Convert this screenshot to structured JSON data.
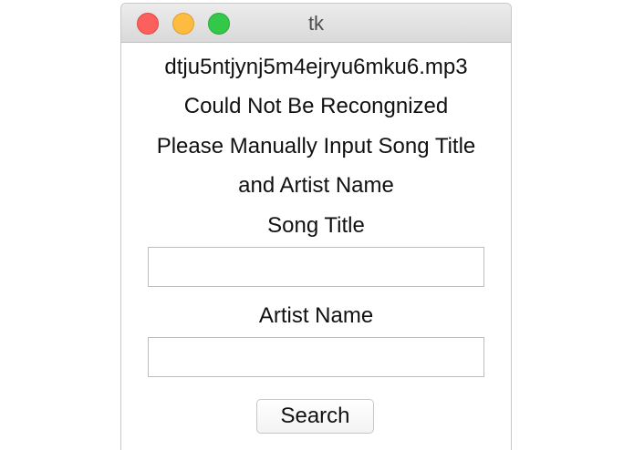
{
  "window": {
    "title": "tk"
  },
  "message": {
    "filename": "dtju5ntjynj5m4ejryu6mku6.mp3",
    "status": "Could Not Be Recongnized",
    "instruction_line1": "Please Manually Input Song Title",
    "instruction_line2": "and Artist Name"
  },
  "form": {
    "song_title_label": "Song Title",
    "song_title_value": "",
    "artist_name_label": "Artist Name",
    "artist_name_value": "",
    "search_button_label": "Search"
  },
  "colors": {
    "close": "#fc605c",
    "minimize": "#fdbc40",
    "zoom": "#34c84a"
  }
}
